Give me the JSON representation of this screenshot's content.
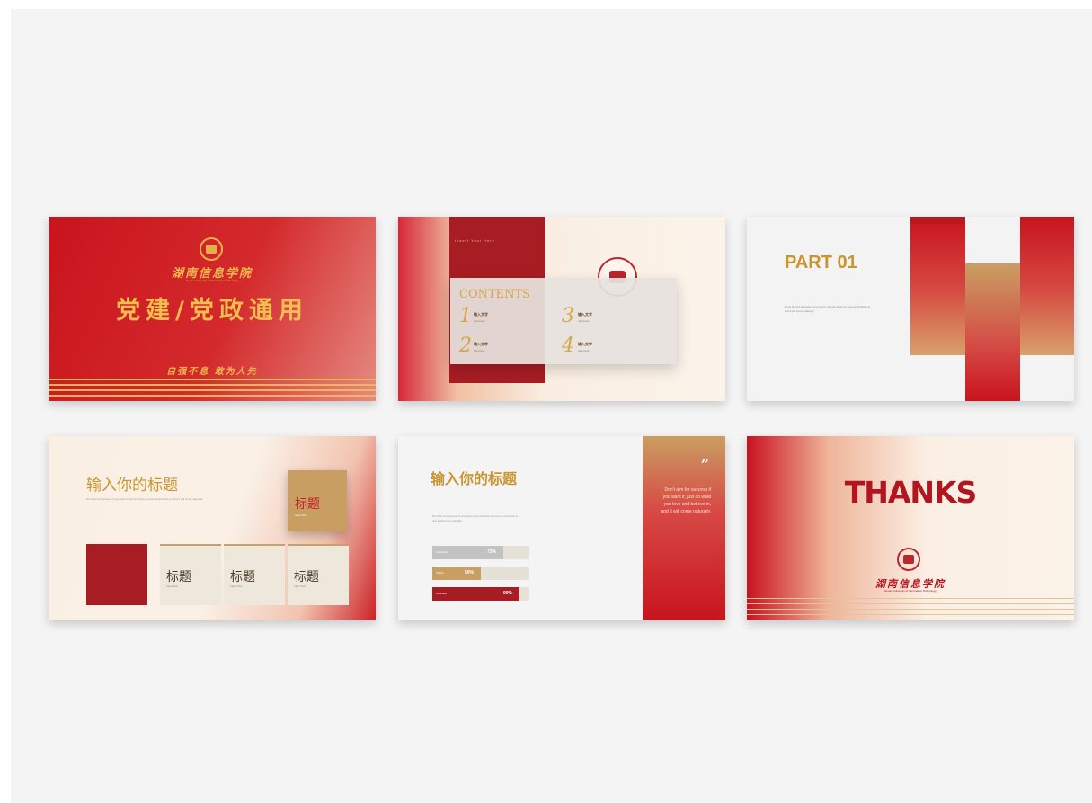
{
  "slide1": {
    "logo_script": "湖南信息学院",
    "logo_sub": "Hunan University of Information Technology",
    "title": "党建/党政通用",
    "slogan": "自强不息  敢为人先",
    "colors": {
      "bg": "#c8141d",
      "gold": "#f4bd4f"
    }
  },
  "slide2": {
    "header_small": "Insert Your Here",
    "contents_label": "CONTENTS",
    "items": [
      {
        "num": "1",
        "title": "输入文字",
        "sub": "Input text"
      },
      {
        "num": "2",
        "title": "输入文字",
        "sub": "Input text"
      },
      {
        "num": "3",
        "title": "输入文字",
        "sub": "Input text"
      },
      {
        "num": "4",
        "title": "输入文字",
        "sub": "Input text"
      }
    ]
  },
  "slide3": {
    "title": "PART 01",
    "body": "Don't aim for success if you want it; just do what you love and believe in, and it will come naturally."
  },
  "slide4": {
    "title": "输入你的标题",
    "body": "Don't aim for success if you want it; just do what you love and believe in, and it will come naturally.",
    "card_title": "标题",
    "card_sub": "Input Text",
    "cards": [
      {
        "title": "标题",
        "sub": "Input Text"
      },
      {
        "title": "标题",
        "sub": "Input Text"
      },
      {
        "title": "标题",
        "sub": "Input Text"
      }
    ]
  },
  "slide5": {
    "title": "输入你的标题",
    "body": "Don't aim for success if you want it; just do what you love and believe in, and it will come naturally.",
    "bars": [
      {
        "label": "Facebook",
        "value": "73%",
        "fraction": 0.73,
        "color": "#c2c2c2",
        "track": "#e6e1d6"
      },
      {
        "label": "Twitter",
        "value": "50%",
        "fraction": 0.5,
        "color": "#c99e62",
        "track": "#e6e1d6"
      },
      {
        "label": "Pinterest",
        "value": "90%",
        "fraction": 0.9,
        "color": "#a71d23",
        "track": "#e6e1d6"
      }
    ],
    "quote_mark": "”",
    "quote_text": "Don't aim for success if you want it; just do what you love and believe in, and it will come naturally."
  },
  "slide6": {
    "thanks": "THANKS",
    "logo_script": "湖南信息学院",
    "logo_sub": "Hunan University of Information Technology"
  }
}
